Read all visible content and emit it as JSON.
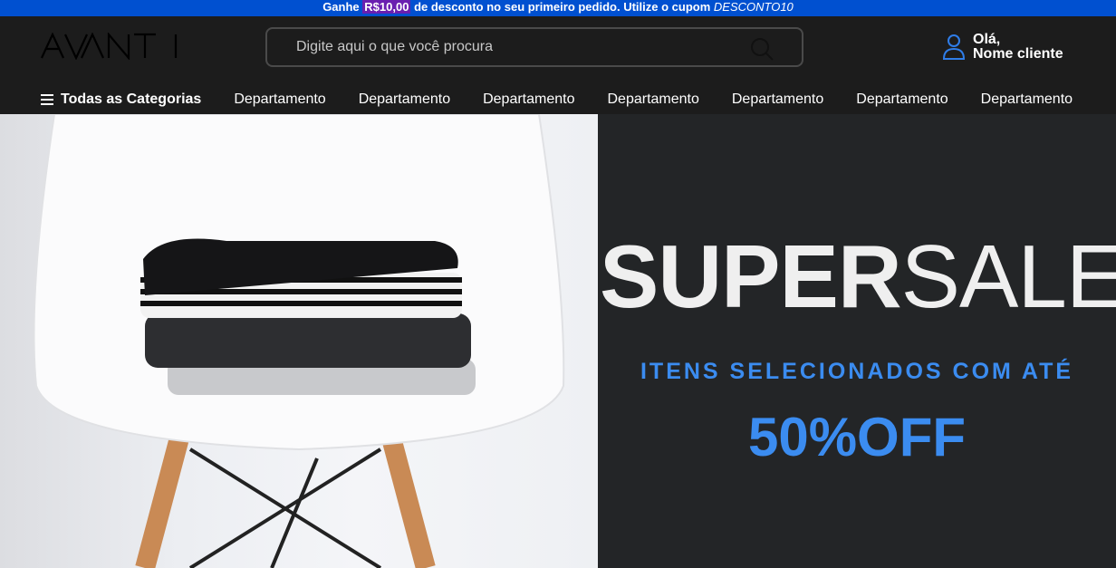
{
  "promo": {
    "prefix": "Ganhe",
    "amount": "R$10,00",
    "middle": "de desconto no seu primeiro pedido. Utilize o cupom",
    "coupon": "DESCONTO10"
  },
  "header": {
    "logo_text": "AVANTI",
    "search_placeholder": "Digite aqui o que você procura",
    "account_greeting": "Olá,",
    "account_name": "Nome cliente"
  },
  "nav": {
    "all_categories": "Todas as Categorias",
    "departments": [
      "Departamento",
      "Departamento",
      "Departamento",
      "Departamento",
      "Departamento",
      "Departamento",
      "Departamento"
    ]
  },
  "hero": {
    "title_bold": "SUPER",
    "title_light": "SALE",
    "subtitle": "ITENS SELECIONADOS COM ATÉ",
    "discount": "50%OFF"
  },
  "colors": {
    "promo_bg": "#0050d0",
    "header_bg": "#1c1c1c",
    "accent_blue": "#3b8cf0",
    "hero_panel_bg": "#232527"
  },
  "icons": {
    "search": "search-icon",
    "account": "user-icon",
    "menu": "hamburger-icon"
  }
}
